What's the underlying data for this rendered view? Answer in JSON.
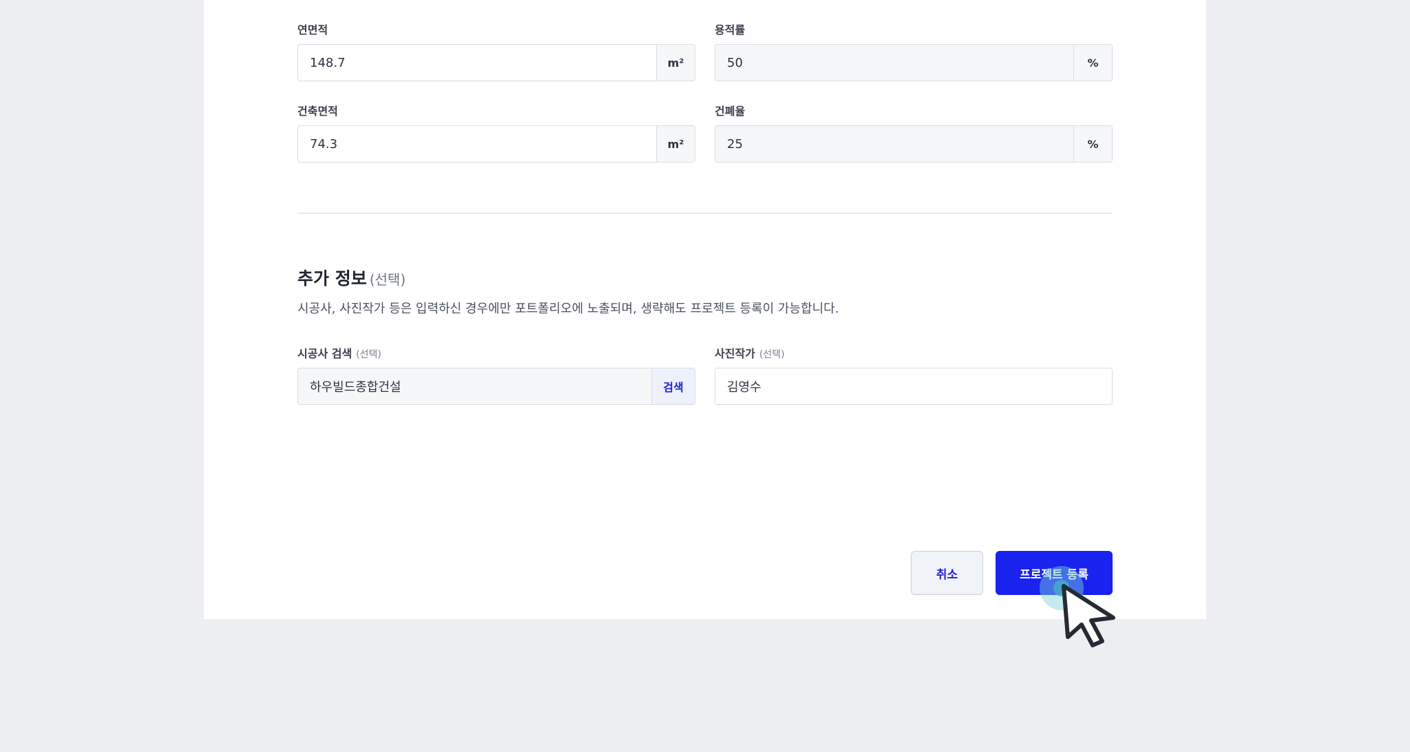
{
  "building": {
    "gross_floor_area": {
      "label": "연면적",
      "value": "148.7",
      "unit": "m²"
    },
    "floor_area_ratio": {
      "label": "용적률",
      "value": "50",
      "unit": "%"
    },
    "building_area": {
      "label": "건축면적",
      "value": "74.3",
      "unit": "m²"
    },
    "building_coverage_ratio": {
      "label": "건폐율",
      "value": "25",
      "unit": "%"
    }
  },
  "additional": {
    "title": "추가 정보",
    "title_optional": "(선택)",
    "description": "시공사, 사진작가 등은 입력하신 경우에만 포트폴리오에 노출되며, 생략해도 프로젝트 등록이 가능합니다.",
    "contractor": {
      "label": "시공사 검색",
      "optional": "(선택)",
      "value": "하우빌드종합건설",
      "search_label": "검색"
    },
    "photographer": {
      "label": "사진작가",
      "optional": "(선택)",
      "value": "김영수"
    }
  },
  "actions": {
    "cancel_label": "취소",
    "submit_label": "프로젝트 등록"
  },
  "colors": {
    "primary": "#1a22f0",
    "accent_text": "#1a22d8",
    "page_background": "#eceef2",
    "card_background": "#ffffff"
  },
  "icons": {
    "cursor": "mouse-pointer-icon"
  }
}
